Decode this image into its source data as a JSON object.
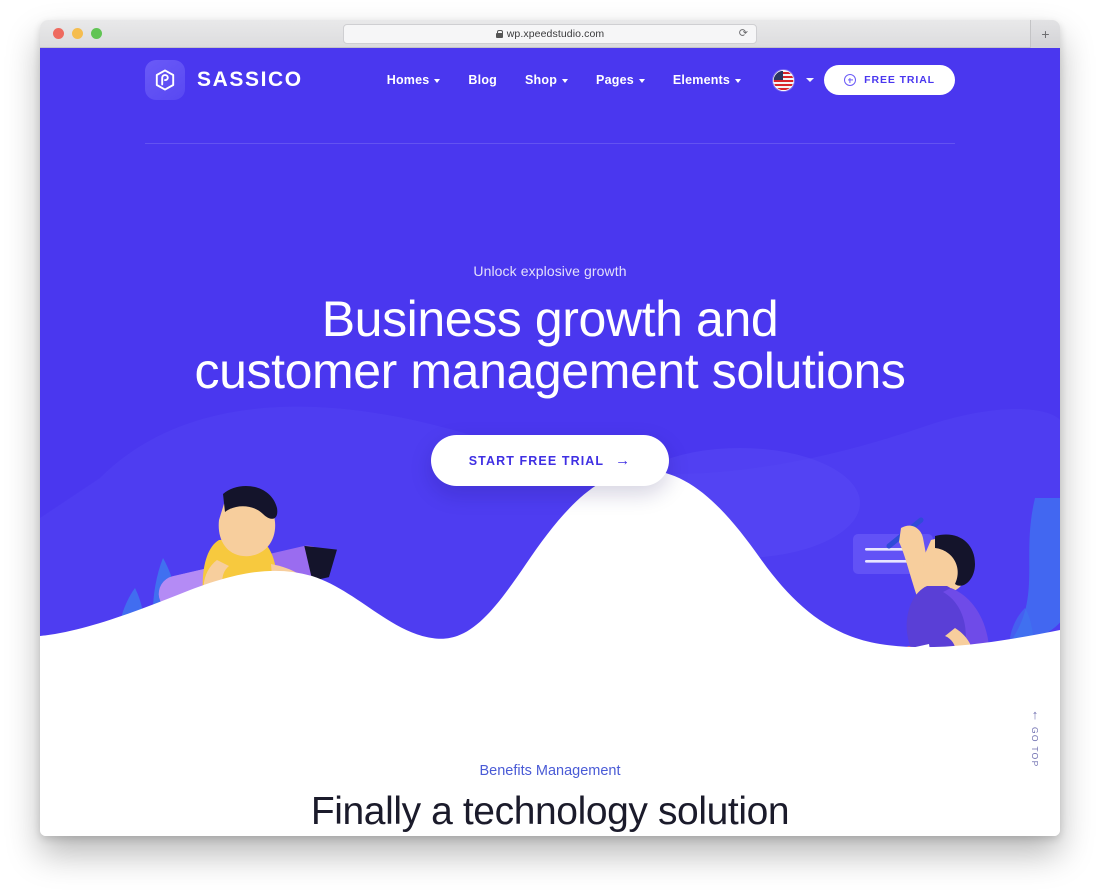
{
  "browser": {
    "url": "wp.xpeedstudio.com",
    "lock_icon": "lock-icon",
    "reload_icon": "reload-icon",
    "newtab_label": "+",
    "traffic_lights": [
      "close",
      "minimize",
      "zoom"
    ]
  },
  "header": {
    "logo_text": "SASSICO",
    "logo_icon": "hexagon-logo-icon",
    "nav": [
      {
        "label": "Homes",
        "has_caret": true
      },
      {
        "label": "Blog",
        "has_caret": false
      },
      {
        "label": "Shop",
        "has_caret": true
      },
      {
        "label": "Pages",
        "has_caret": true
      },
      {
        "label": "Elements",
        "has_caret": true
      }
    ],
    "language": {
      "flag": "us-flag-icon",
      "has_caret": true
    },
    "trial_button": {
      "label": "FREE TRIAL",
      "icon": "plus-circle-icon"
    }
  },
  "hero": {
    "eyebrow": "Unlock explosive growth",
    "title_line1": "Business growth and",
    "title_line2": "customer management solutions",
    "cta": {
      "label": "START FREE TRIAL",
      "icon": "arrow-right-icon"
    },
    "illustration_left": "man-carrying-pencil-illustration",
    "illustration_right": "person-writing-on-board-illustration"
  },
  "benefits": {
    "eyebrow": "Benefits Management",
    "title": "Finally a technology solution"
  },
  "gotop": {
    "label": "GO TOP",
    "icon": "arrow-up-icon"
  },
  "colors": {
    "hero_bg": "#4a37ef",
    "accent_purple": "#6a5af7",
    "benefits_eyebrow": "#4a5bd6",
    "heading_dark": "#1b1b2b",
    "white": "#ffffff"
  }
}
